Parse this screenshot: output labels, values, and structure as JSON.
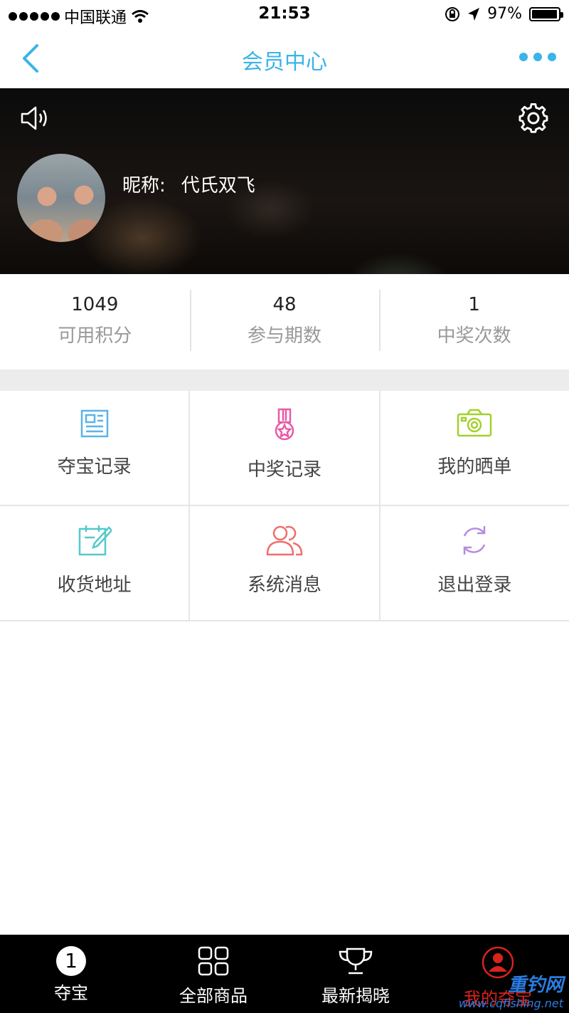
{
  "status_bar": {
    "carrier": "中国联通",
    "time": "21:53",
    "battery": "97%",
    "battery_level": 0.97
  },
  "nav": {
    "title": "会员中心"
  },
  "profile": {
    "nickname_label": "昵称:",
    "nickname": "代氏双飞"
  },
  "stats": [
    {
      "value": "1049",
      "label": "可用积分"
    },
    {
      "value": "48",
      "label": "参与期数"
    },
    {
      "value": "1",
      "label": "中奖次数"
    }
  ],
  "menu": [
    {
      "label": "夺宝记录",
      "icon": "document-icon",
      "color": "#5ab4e6"
    },
    {
      "label": "中奖记录",
      "icon": "medal-icon",
      "color": "#e85aa7"
    },
    {
      "label": "我的晒单",
      "icon": "camera-icon",
      "color": "#a4d02c"
    },
    {
      "label": "收货地址",
      "icon": "edit-calendar-icon",
      "color": "#54c9c9"
    },
    {
      "label": "系统消息",
      "icon": "users-icon",
      "color": "#ef6f6f"
    },
    {
      "label": "退出登录",
      "icon": "refresh-icon",
      "color": "#b68be0"
    }
  ],
  "tabs": [
    {
      "label": "夺宝",
      "badge": "1"
    },
    {
      "label": "全部商品"
    },
    {
      "label": "最新揭晓"
    },
    {
      "label": "我的夺宝"
    }
  ],
  "watermark": {
    "line1": "重钓网",
    "line2": "www.cqfishing.net"
  }
}
